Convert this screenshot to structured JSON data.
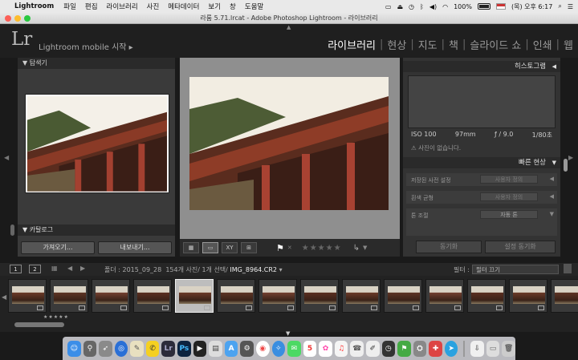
{
  "menubar": {
    "app": "Lightroom",
    "items": [
      "파일",
      "편집",
      "라이브러리",
      "사진",
      "메타데이터",
      "보기",
      "창",
      "도움말"
    ],
    "battery": "100%",
    "clock": "(목) 오후 6:17"
  },
  "window": {
    "title": "라룸 5.71.lrcat - Adobe Photoshop Lightroom - 라이브러리"
  },
  "identity": {
    "logo": "Lr",
    "mobile_label": "Lightroom mobile 시작 ▸"
  },
  "modules": {
    "items": [
      "라이브러리",
      "현상",
      "지도",
      "책",
      "슬라이드 쇼",
      "인쇄",
      "웹"
    ],
    "active": "라이브러리"
  },
  "left_panel": {
    "navigator_label": "탐색기",
    "catalog_label": "카탈로그",
    "import_button": "가져오기...",
    "export_button": "내보내기..."
  },
  "right_panel": {
    "histogram_label": "히스토그램",
    "exif": {
      "iso": "ISO 100",
      "focal": "97mm",
      "aperture": "ƒ / 9.0",
      "shutter": "1/80초"
    },
    "no_photo": "사진이 없습니다.",
    "quick_develop_label": "빠른 현상",
    "preset_label": "저장된 사전 설정",
    "preset_value": "사용자 정의",
    "wb_label": "흰색 균형",
    "wb_value": "사용자 정의",
    "tone_label": "톤 조절",
    "tone_value": "자동 톤",
    "sync_button": "동기화",
    "sync_settings_button": "설정 동기화"
  },
  "filmstrip": {
    "page1": "1",
    "page2": "2",
    "folder": "폴더 : 2015_09_28",
    "count": "154개 사진/ 1개 선택/",
    "filename": "IMG_8964.CR2",
    "filter_label": "필터 :",
    "filter_value": "필터 끄기",
    "thumb_count": 14,
    "selected_index": 4,
    "stars": "★★★★★"
  },
  "toolbar": {
    "grid": "▦",
    "loupe": "▭",
    "compare": "XY",
    "survey": "⊞",
    "flag": "⚑",
    "stars": "★★★★★"
  },
  "colors": {
    "accent": "#ffffff",
    "panel": "#3a3a3a",
    "background": "#8f8f8f"
  }
}
